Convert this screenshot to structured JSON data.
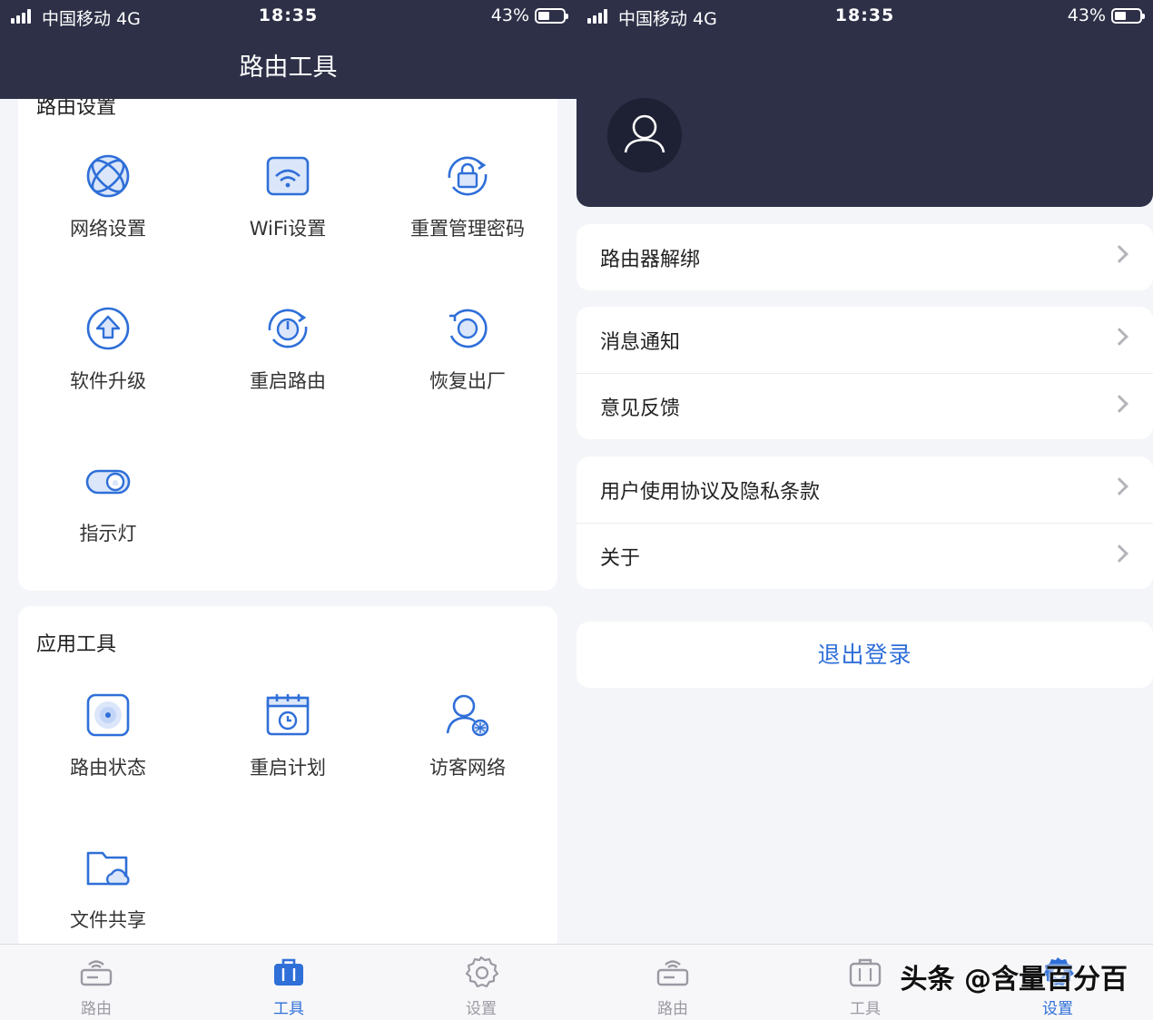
{
  "status_bar": {
    "carrier": "中国移动  4G",
    "time": "18:35",
    "battery": "43%"
  },
  "left": {
    "header_title": "路由工具",
    "router_settings": {
      "title": "路由设置",
      "items": [
        {
          "label": "网络设置",
          "icon": "globe-icon"
        },
        {
          "label": "WiFi设置",
          "icon": "wifi-icon"
        },
        {
          "label": "重置管理密码",
          "icon": "lock-reset-icon"
        },
        {
          "label": "软件升级",
          "icon": "upgrade-icon"
        },
        {
          "label": "重启路由",
          "icon": "restart-icon"
        },
        {
          "label": "恢复出厂",
          "icon": "factory-reset-icon"
        },
        {
          "label": "指示灯",
          "icon": "indicator-light-icon"
        }
      ]
    },
    "app_tools": {
      "title": "应用工具",
      "items": [
        {
          "label": "路由状态",
          "icon": "router-status-icon"
        },
        {
          "label": "重启计划",
          "icon": "calendar-clock-icon"
        },
        {
          "label": "访客网络",
          "icon": "guest-user-icon"
        },
        {
          "label": "文件共享",
          "icon": "folder-cloud-icon"
        }
      ]
    }
  },
  "right": {
    "groups": [
      [
        "路由器解绑"
      ],
      [
        "消息通知",
        "意见反馈"
      ],
      [
        "用户使用协议及隐私条款",
        "关于"
      ]
    ],
    "logout_label": "退出登录"
  },
  "tabs": [
    {
      "label": "路由",
      "icon": "router-icon"
    },
    {
      "label": "工具",
      "icon": "toolbox-icon"
    },
    {
      "label": "设置",
      "icon": "gear-icon"
    }
  ],
  "left_active_tab": "工具",
  "right_active_tab": "设置",
  "watermark": "头条 @含量百分百",
  "colors": {
    "header": "#2d3047",
    "accent": "#2f6fd8",
    "icon_fill": "#dbe6fa",
    "background": "#f4f5f9"
  }
}
